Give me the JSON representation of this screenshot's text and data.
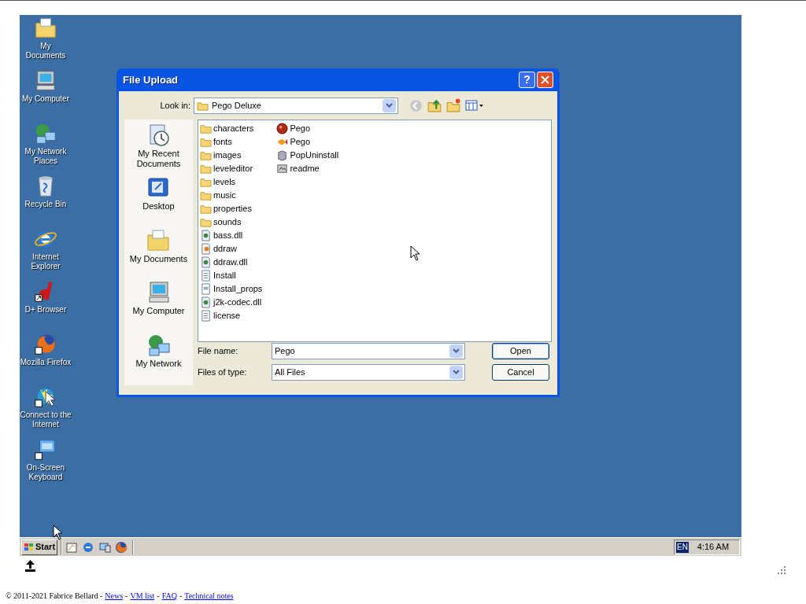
{
  "desktop": {
    "icons": [
      {
        "label": "My Documents",
        "kind": "documents"
      },
      {
        "label": "My Computer",
        "kind": "computer"
      },
      {
        "label": "My Network Places",
        "kind": "network"
      },
      {
        "label": "Recycle Bin",
        "kind": "recycle"
      },
      {
        "label": "Internet Explorer",
        "kind": "ie"
      },
      {
        "label": "D+ Browser",
        "kind": "dplus"
      },
      {
        "label": "Mozilla Firefox",
        "kind": "firefox"
      },
      {
        "label": "Connect to the Internet",
        "kind": "connect"
      },
      {
        "label": "On-Screen Keyboard",
        "kind": "keyboard"
      }
    ]
  },
  "dialog": {
    "title": "File Upload",
    "help": "?",
    "look_in_label": "Look in:",
    "look_in": "Pego Deluxe",
    "places": [
      {
        "label": "My Recent Documents",
        "kind": "recent"
      },
      {
        "label": "Desktop",
        "kind": "desktop"
      },
      {
        "label": "My Documents",
        "kind": "documents"
      },
      {
        "label": "My Computer",
        "kind": "computer"
      },
      {
        "label": "My Network",
        "kind": "network"
      }
    ],
    "files": [
      {
        "name": "characters",
        "kind": "folder"
      },
      {
        "name": "fonts",
        "kind": "folder"
      },
      {
        "name": "images",
        "kind": "folder"
      },
      {
        "name": "leveleditor",
        "kind": "folder"
      },
      {
        "name": "levels",
        "kind": "folder"
      },
      {
        "name": "music",
        "kind": "folder"
      },
      {
        "name": "properties",
        "kind": "folder"
      },
      {
        "name": "sounds",
        "kind": "folder"
      },
      {
        "name": "bass.dll",
        "kind": "dll"
      },
      {
        "name": "ddraw",
        "kind": "config"
      },
      {
        "name": "ddraw.dll",
        "kind": "dll"
      },
      {
        "name": "Install",
        "kind": "text"
      },
      {
        "name": "Install_props",
        "kind": "props"
      },
      {
        "name": "j2k-codec.dll",
        "kind": "dll"
      },
      {
        "name": "license",
        "kind": "text"
      },
      {
        "name": "Pego",
        "kind": "ball"
      },
      {
        "name": "Pego",
        "kind": "fish"
      },
      {
        "name": "PopUninstall",
        "kind": "uninstall"
      },
      {
        "name": "readme",
        "kind": "readme"
      }
    ],
    "file_name_label": "File name:",
    "file_name": "Pego",
    "type_label": "Files of type:",
    "file_type": "All Files",
    "buttons": [
      {
        "label": "Open",
        "default": true
      },
      {
        "label": "Cancel",
        "default": false
      }
    ]
  },
  "taskbar": {
    "start": "Start",
    "language": "EN",
    "clock": "4:16 AM"
  },
  "footer": [
    {
      "kind": "text",
      "text": "© 2011-2021 Fabrice Bellard -"
    },
    {
      "kind": "link",
      "text": "News"
    },
    {
      "kind": "text",
      "text": "-"
    },
    {
      "kind": "link",
      "text": "VM list"
    },
    {
      "kind": "text",
      "text": "-"
    },
    {
      "kind": "link",
      "text": "FAQ"
    },
    {
      "kind": "text",
      "text": "-"
    },
    {
      "kind": "link",
      "text": "Technical notes"
    }
  ]
}
